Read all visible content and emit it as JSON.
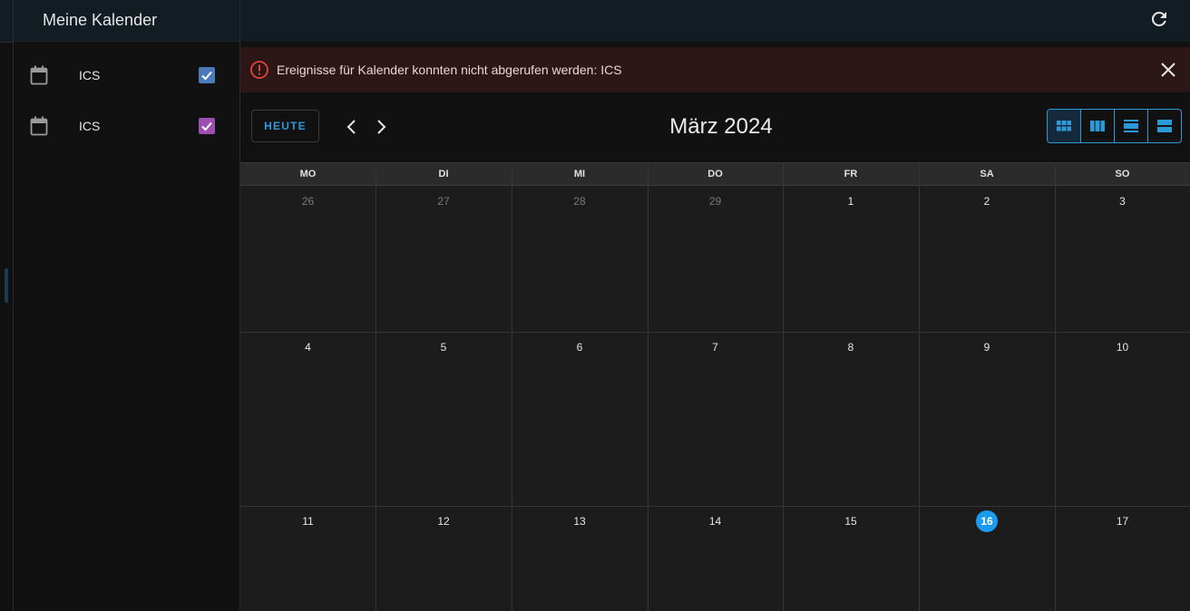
{
  "sidebar": {
    "title": "Meine Kalender",
    "calendars": [
      {
        "label": "ICS",
        "color": "#4a7bb8",
        "checked": true
      },
      {
        "label": "ICS",
        "color": "#9c4fb0",
        "checked": true
      }
    ]
  },
  "alert": {
    "message": "Ereignisse für Kalender konnten nicht abgerufen werden: ICS",
    "icon": "error-circle-icon",
    "close_icon": "close-icon"
  },
  "toolbar": {
    "today_label": "HEUTE",
    "prev_icon": "chevron-left-icon",
    "next_icon": "chevron-right-icon",
    "month_title": "März 2024",
    "views": [
      "month-view-icon",
      "week-view-icon",
      "day-view-icon",
      "list-view-icon"
    ],
    "refresh_icon": "refresh-icon"
  },
  "calendar": {
    "weekdays": [
      "MO",
      "DI",
      "MI",
      "DO",
      "FR",
      "SA",
      "SO"
    ],
    "weeks": [
      [
        {
          "d": "26",
          "muted": true
        },
        {
          "d": "27",
          "muted": true
        },
        {
          "d": "28",
          "muted": true
        },
        {
          "d": "29",
          "muted": true
        },
        {
          "d": "1"
        },
        {
          "d": "2"
        },
        {
          "d": "3"
        }
      ],
      [
        {
          "d": "4"
        },
        {
          "d": "5"
        },
        {
          "d": "6"
        },
        {
          "d": "7"
        },
        {
          "d": "8"
        },
        {
          "d": "9"
        },
        {
          "d": "10"
        }
      ],
      [
        {
          "d": "11"
        },
        {
          "d": "12"
        },
        {
          "d": "13"
        },
        {
          "d": "14"
        },
        {
          "d": "15"
        },
        {
          "d": "16",
          "today": true
        },
        {
          "d": "17"
        }
      ]
    ]
  },
  "colors": {
    "accent": "#2c9ad8",
    "today_badge": "#1a9bf0",
    "alert_bg": "#2d1716",
    "alert_icon": "#e0443a"
  }
}
